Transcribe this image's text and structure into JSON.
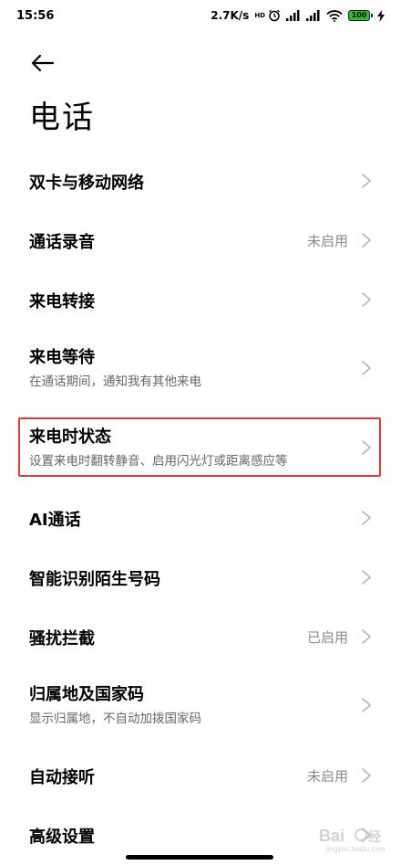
{
  "status_bar": {
    "time": "15:56",
    "network_speed": "2.7K/s",
    "hd_label": "HD",
    "battery": "100",
    "icons": [
      "alarm-icon",
      "signal-icon",
      "signal-icon",
      "wifi-icon",
      "battery-icon",
      "charging-icon"
    ]
  },
  "header": {
    "back_icon": "arrow-left-icon",
    "title": "电话"
  },
  "settings": [
    {
      "title": "双卡与移动网络",
      "subtitle": "",
      "value": ""
    },
    {
      "title": "通话录音",
      "subtitle": "",
      "value": "未启用"
    },
    {
      "title": "来电转接",
      "subtitle": "",
      "value": ""
    },
    {
      "title": "来电等待",
      "subtitle": "在通话期间，通知我有其他来电",
      "value": ""
    },
    {
      "title": "来电时状态",
      "subtitle": "设置来电时翻转静音、启用闪光灯或距离感应等",
      "value": ""
    },
    {
      "title": "AI通话",
      "subtitle": "",
      "value": ""
    },
    {
      "title": "智能识别陌生号码",
      "subtitle": "",
      "value": ""
    },
    {
      "title": "骚扰拦截",
      "subtitle": "",
      "value": "已启用"
    },
    {
      "title": "归属地及国家码",
      "subtitle": "显示归属地，不自动加拨国家码",
      "value": ""
    },
    {
      "title": "自动接听",
      "subtitle": "",
      "value": "未启用"
    },
    {
      "title": "高级设置",
      "subtitle": "",
      "value": ""
    }
  ],
  "colors": {
    "highlight": "#e53935",
    "battery": "#2fbd34",
    "secondary_text": "#8a8a8a"
  }
}
